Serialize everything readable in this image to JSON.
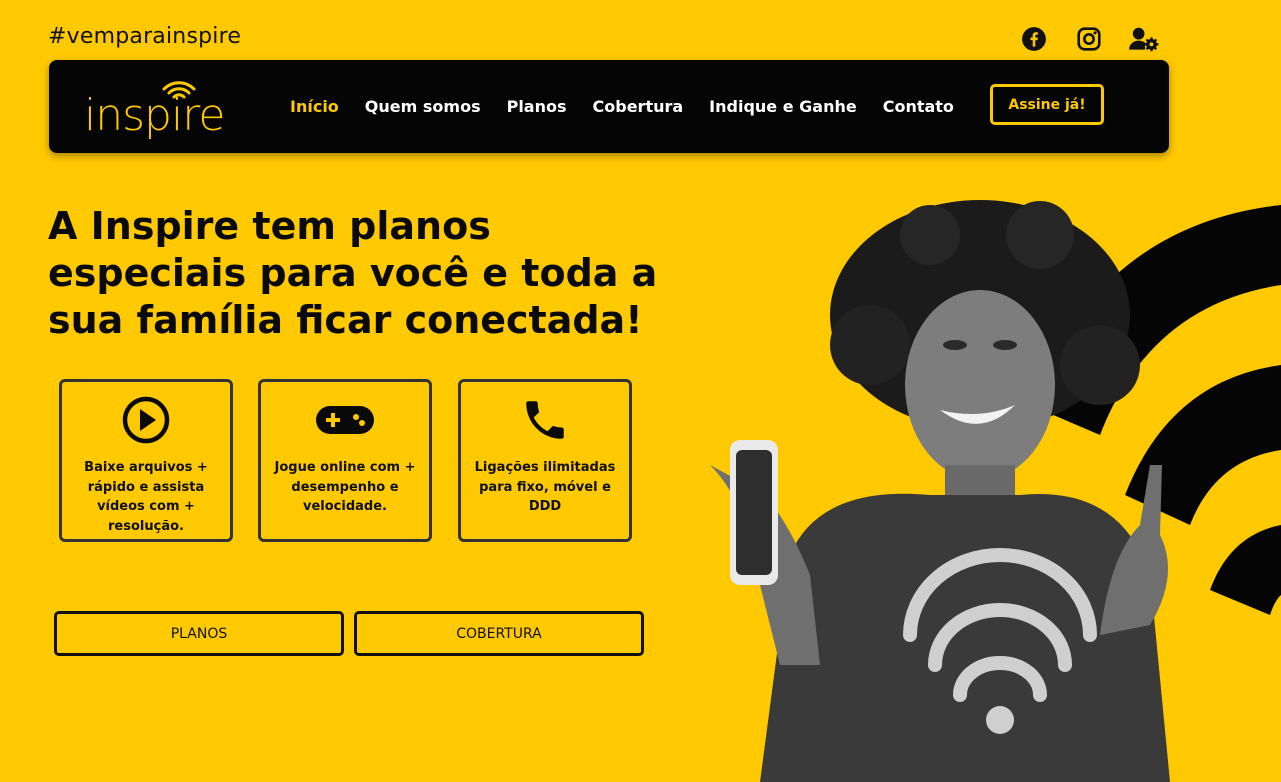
{
  "topbar": {
    "hashtag": "#vemparainspire",
    "icons": [
      "facebook-icon",
      "instagram-icon",
      "user-settings-icon"
    ]
  },
  "navbar": {
    "logo_text": "inspire",
    "links": [
      {
        "label": "Início",
        "active": true
      },
      {
        "label": "Quem somos",
        "active": false
      },
      {
        "label": "Planos",
        "active": false
      },
      {
        "label": "Cobertura",
        "active": false
      },
      {
        "label": "Indique e Ganhe",
        "active": false
      },
      {
        "label": "Contato",
        "active": false
      }
    ],
    "cta_label": "Assine já!"
  },
  "hero": {
    "headline": "A Inspire tem planos especiais para você e toda a sua família ficar conectada!",
    "features": [
      {
        "icon": "play-circle-icon",
        "text": "Baixe arquivos + rápido e assista vídeos com + resolução."
      },
      {
        "icon": "gamepad-icon",
        "text": "Jogue online com + desempenho e velocidade."
      },
      {
        "icon": "phone-icon",
        "text": "Ligações ilimitadas para fixo, móvel e DDD"
      }
    ],
    "buttons": {
      "plans": "PLANOS",
      "coverage": "COBERTURA"
    }
  },
  "colors": {
    "brand_yellow": "#ffc900",
    "navbar_bg": "#050505",
    "text_dark": "#111111"
  }
}
